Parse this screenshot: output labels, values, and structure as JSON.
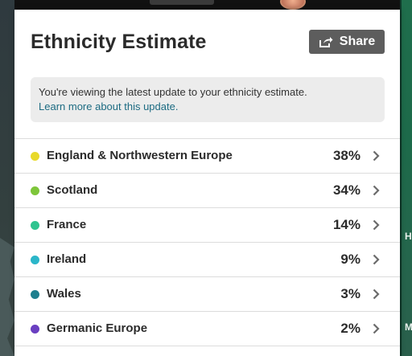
{
  "panel": {
    "title": "Ethnicity Estimate",
    "share_label": "Share",
    "notice": {
      "text": "You're viewing the latest update to your ethnicity estimate.",
      "link": "Learn more about this update."
    }
  },
  "regions": [
    {
      "name": "England & Northwestern Europe",
      "percent": "38%",
      "color": "#e8d92a"
    },
    {
      "name": "Scotland",
      "percent": "34%",
      "color": "#7ec63a"
    },
    {
      "name": "France",
      "percent": "14%",
      "color": "#2fc48f"
    },
    {
      "name": "Ireland",
      "percent": "9%",
      "color": "#2bb6c9"
    },
    {
      "name": "Wales",
      "percent": "3%",
      "color": "#1e7f8e"
    },
    {
      "name": "Germanic Europe",
      "percent": "2%",
      "color": "#6a3fc1"
    }
  ],
  "map": {
    "labels": [
      "Ho",
      "Ma"
    ]
  }
}
